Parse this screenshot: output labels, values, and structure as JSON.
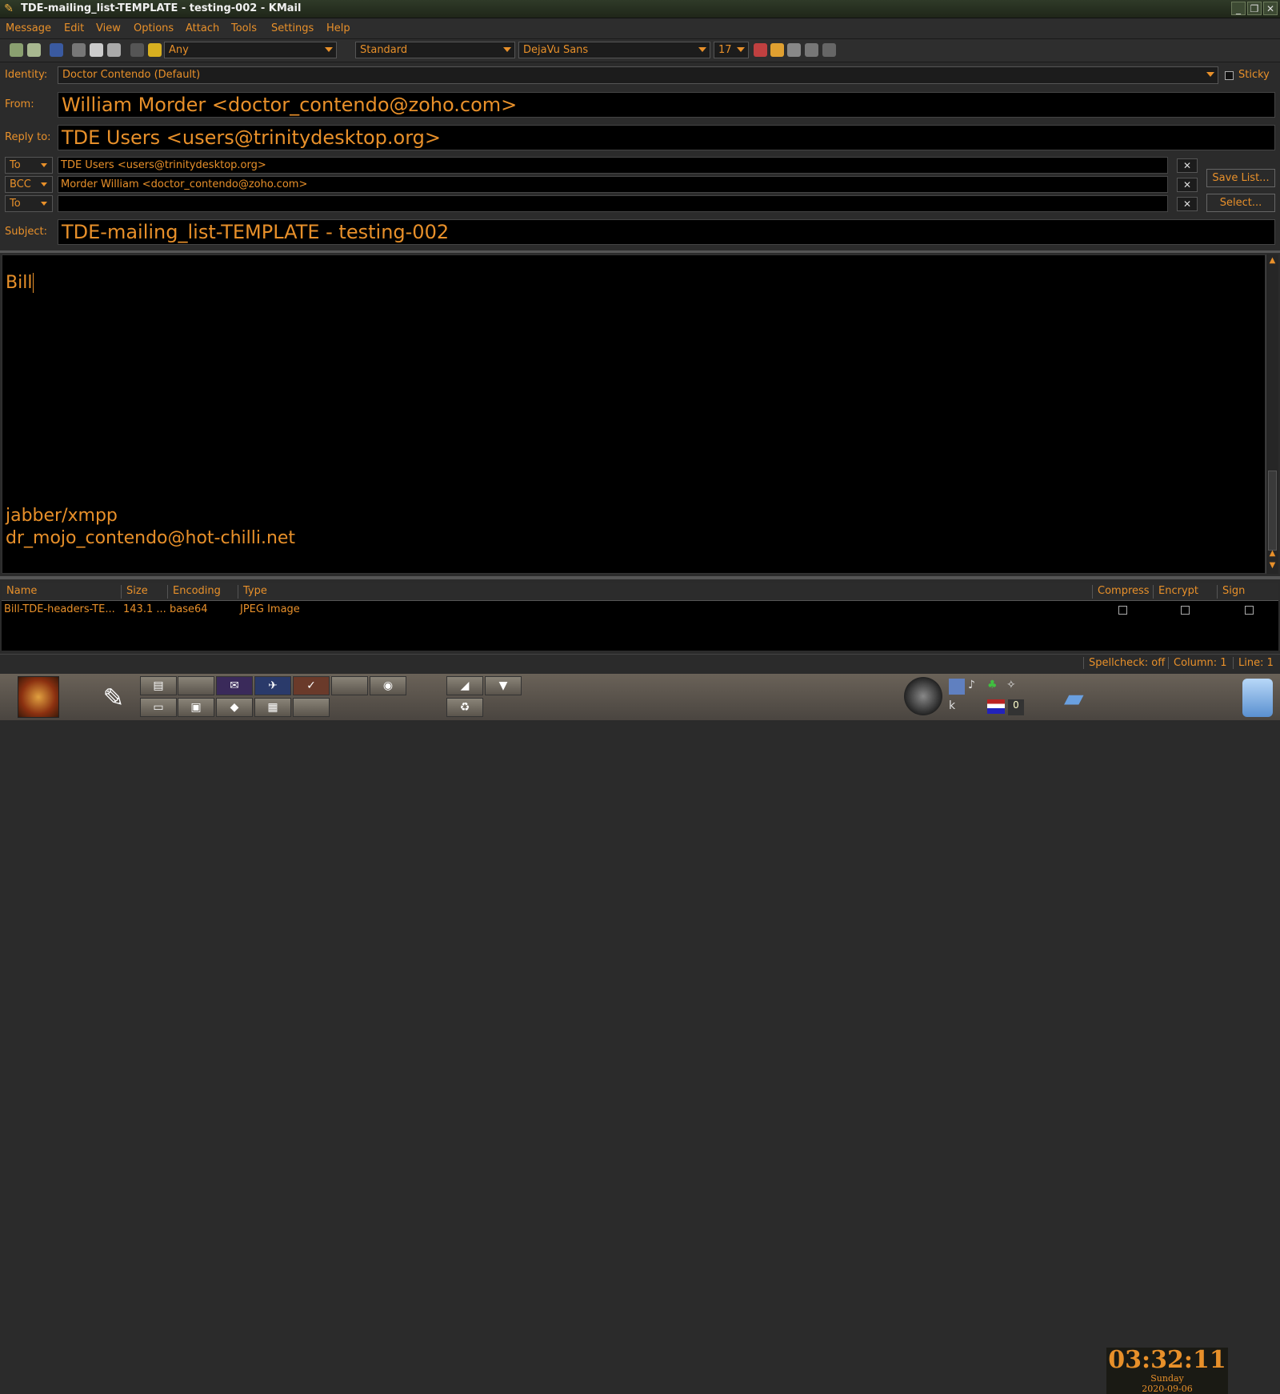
{
  "window": {
    "title": "TDE-mailing_list-TEMPLATE - testing-002 - KMail"
  },
  "menu": [
    "Message",
    "Edit",
    "View",
    "Options",
    "Attach",
    "Tools",
    "Settings",
    "Help"
  ],
  "toolbar": {
    "encryption_combo": "Any",
    "style_combo": "Standard",
    "font_combo": "DejaVu Sans",
    "size_combo": "17"
  },
  "headers": {
    "identity_label": "Identity:",
    "identity_value": "Doctor Contendo (Default)",
    "sticky_label": "Sticky",
    "from_label": "From:",
    "from_value": "William Morder <doctor_contendo@zoho.com>",
    "replyto_label": "Reply to:",
    "replyto_value": "TDE Users <users@trinitydesktop.org>",
    "recipients": [
      {
        "type": "To",
        "value": "TDE Users <users@trinitydesktop.org>"
      },
      {
        "type": "BCC",
        "value": "Morder William <doctor_contendo@zoho.com>"
      },
      {
        "type": "To",
        "value": ""
      }
    ],
    "save_list_label": "Save List...",
    "select_label": "Select...",
    "subject_label": "Subject:",
    "subject_value": "TDE-mailing_list-TEMPLATE - testing-002"
  },
  "body": {
    "lines": [
      "Bill",
      "jabber/xmpp",
      "dr_mojo_contendo@hot-chilli.net"
    ]
  },
  "attachments": {
    "columns": [
      "Name",
      "Size",
      "Encoding",
      "Type",
      "Compress",
      "Encrypt",
      "Sign"
    ],
    "rows": [
      {
        "name": "Bill-TDE-headers-TE...",
        "size": "143.1 ...",
        "encoding": "base64",
        "type": "JPEG Image",
        "compress": false,
        "encrypt": false,
        "sign": false
      }
    ]
  },
  "status": {
    "spellcheck": "Spellcheck: off",
    "column": "Column: 1",
    "line": "Line: 1"
  },
  "clock": {
    "time": "03:32:11",
    "day": "Sunday",
    "date": "2020-09-06"
  },
  "colors": {
    "accent": "#e8902a",
    "background": "#000000"
  }
}
